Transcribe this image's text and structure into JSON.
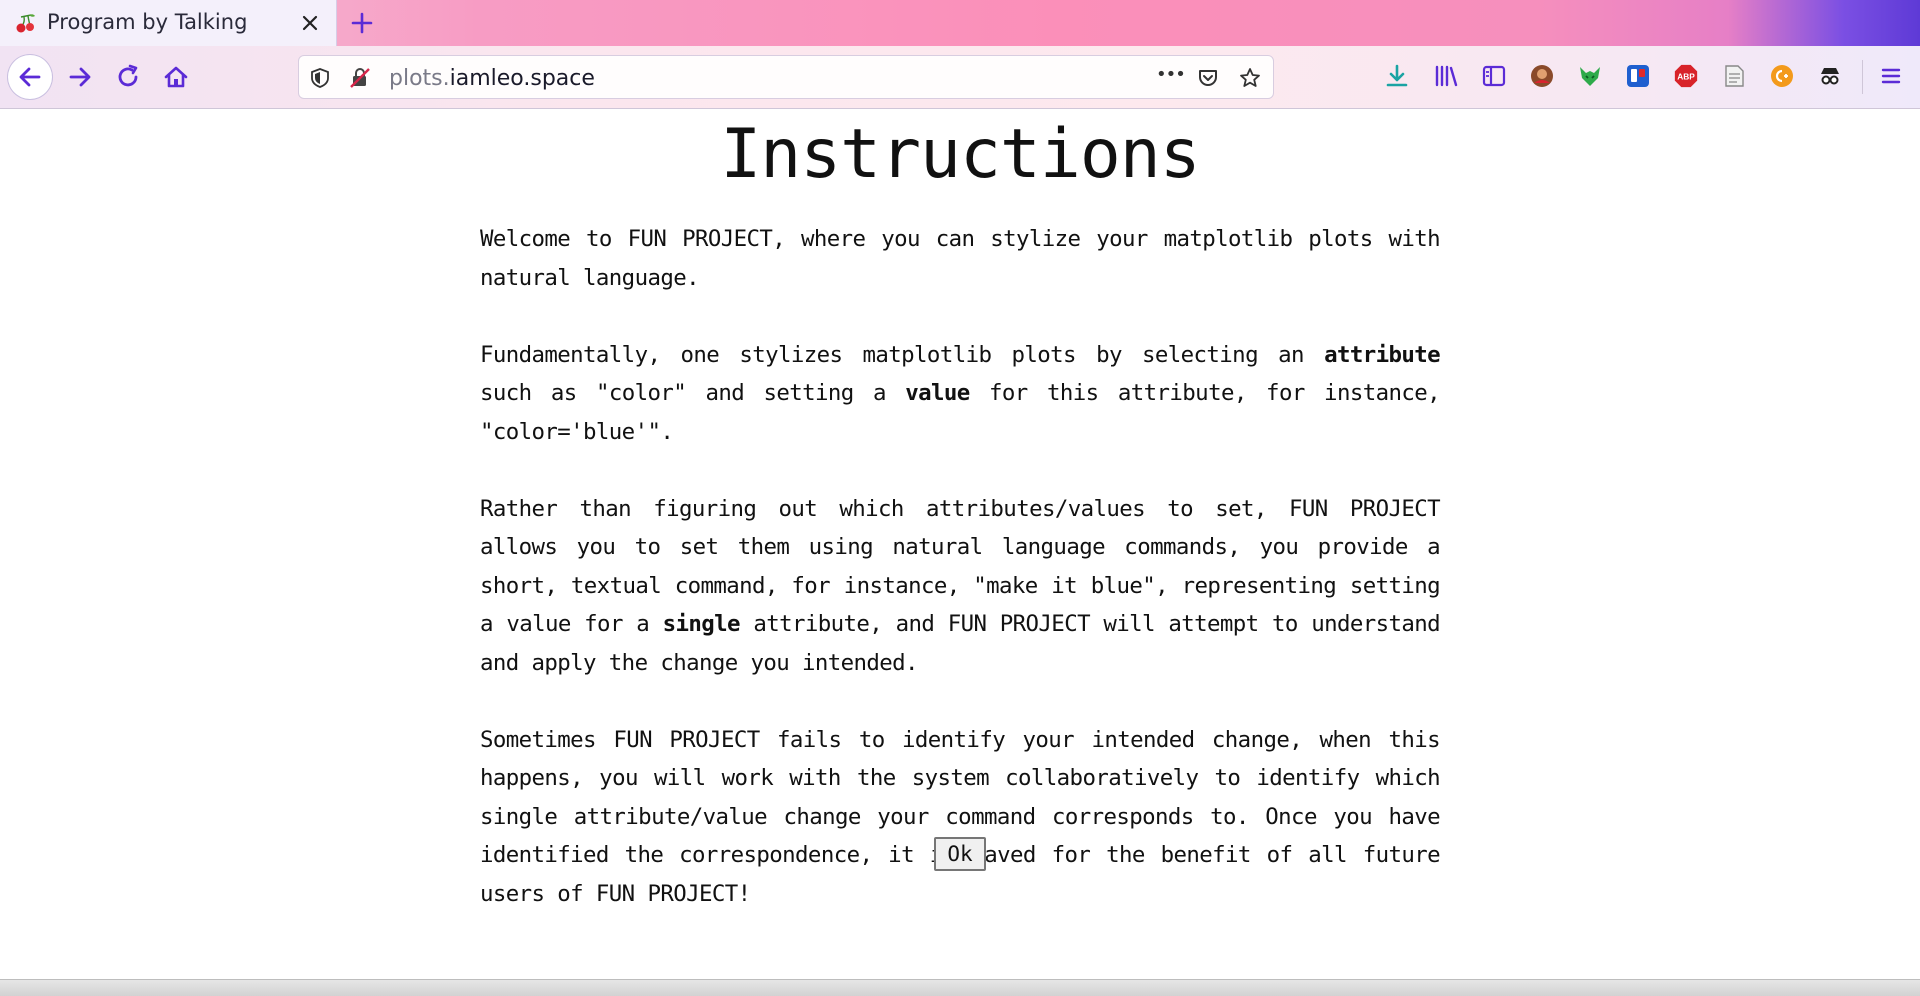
{
  "browser": {
    "tab_title": "Program by Talking",
    "url_host_prefix": "plots.",
    "url_domain": "iamleo.space",
    "url_more": "•••"
  },
  "toolbar_icons": [
    "back-icon",
    "forward-icon",
    "reload-icon",
    "home-icon",
    "shield-icon",
    "insecure-lock-icon",
    "page-actions-icon",
    "pocket-icon",
    "bookmark-star-icon",
    "download-icon",
    "library-icon",
    "sidebar-icon",
    "avatar-extension-icon",
    "fox-extension-icon",
    "trello-extension-icon",
    "adblock-extension-icon",
    "reader-extension-icon",
    "coupon-extension-icon",
    "incognito-extension-icon",
    "menu-icon"
  ],
  "colors": {
    "accent": "#5b2bd6",
    "download": "#1aa3a3"
  },
  "page": {
    "title": "Instructions",
    "p1": "Welcome to FUN PROJECT, where you can stylize your matplotlib plots with natural language.",
    "p2_a": "Fundamentally, one stylizes matplotlib plots by selecting an ",
    "p2_b": "attribute",
    "p2_c": " such as \"color\" and setting a ",
    "p2_d": "value",
    "p2_e": " for this attribute, for instance, \"color='blue'\".",
    "p3_a": "Rather than figuring out which attributes/values to set, FUN PROJECT allows you to set them using natural language commands, you provide a short, textual command, for instance, \"make it blue\", representing setting a value for a ",
    "p3_b": "single",
    "p3_c": " attribute, and FUN PROJECT will attempt to understand and apply the change you intended.",
    "p4": "Sometimes FUN PROJECT fails to identify your intended change, when this happens, you will work with the system collaboratively to identify which single attribute/value change your command corresponds to. Once you have identified the correspondence, it is saved for the benefit of all future users of FUN PROJECT!",
    "ok_label": "Ok"
  }
}
